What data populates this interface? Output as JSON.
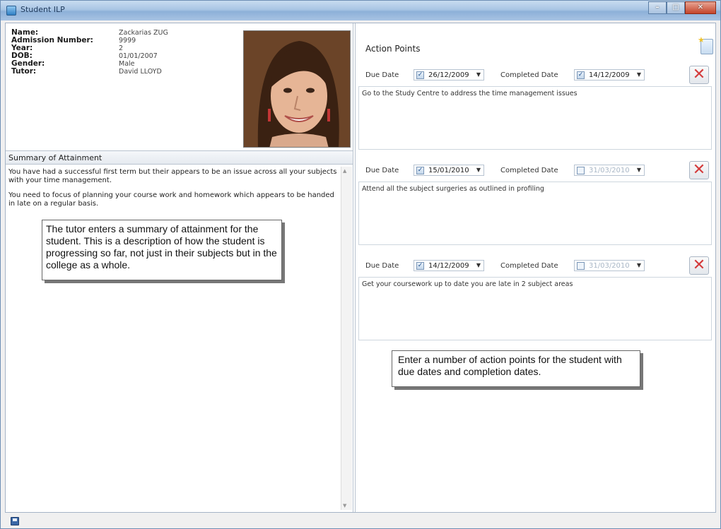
{
  "window": {
    "title": "Student ILP"
  },
  "student": {
    "fields": [
      {
        "label": "Name:",
        "value": "Zackarias ZUG"
      },
      {
        "label": "Admission Number:",
        "value": "9999"
      },
      {
        "label": "Year:",
        "value": "2"
      },
      {
        "label": "DOB:",
        "value": "01/01/2007"
      },
      {
        "label": "Gender:",
        "value": "Male"
      },
      {
        "label": "Tutor:",
        "value": "David LLOYD"
      }
    ]
  },
  "summary": {
    "heading": "Summary of Attainment",
    "paragraphs": [
      "You have had a successful first term but their appears to be an issue across all your subjects with your time management.",
      "You need to focus of planning your course work and homework which appears to be handed in late on a regular basis."
    ]
  },
  "callouts": {
    "left": "The tutor enters a summary of attainment for the student.  This is a description of how the student is progressing so far, not just in their subjects but in the college as a whole.",
    "right": "Enter a number of action points for the student with due dates and completion dates."
  },
  "action_points": {
    "heading": "Action Points",
    "due_label": "Due Date",
    "completed_label": "Completed Date",
    "items": [
      {
        "due_date": "26/12/2009",
        "due_checked": true,
        "completed_date": "14/12/2009",
        "completed_checked": true,
        "text": "Go to the Study Centre to address the time management issues"
      },
      {
        "due_date": "15/01/2010",
        "due_checked": true,
        "completed_date": "31/03/2010",
        "completed_checked": false,
        "text": "Attend all the subject surgeries as outlined in profiling"
      },
      {
        "due_date": "14/12/2009",
        "due_checked": true,
        "completed_date": "31/03/2010",
        "completed_checked": false,
        "text": "Get your coursework up to date you are late in 2 subject areas"
      }
    ]
  },
  "icons": {
    "app": "application-icon",
    "new_action": "new-action-point-icon",
    "delete": "delete-x-icon",
    "save": "save-disk-icon"
  },
  "colors": {
    "delete_red": "#d43c3c",
    "titlebar": "#a9c5e4"
  }
}
